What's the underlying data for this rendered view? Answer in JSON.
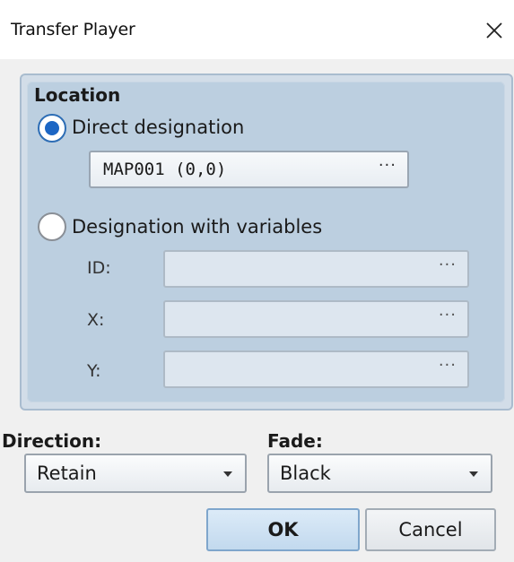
{
  "window": {
    "title": "Transfer Player",
    "close_icon": "close-icon"
  },
  "location": {
    "group_label": "Location",
    "direct": {
      "label": "Direct designation",
      "checked": true,
      "value": "MAP001 (0,0)",
      "browse_label": "···"
    },
    "variables": {
      "label": "Designation with variables",
      "checked": false,
      "fields": [
        {
          "label": "ID:",
          "value": "",
          "browse_label": "···"
        },
        {
          "label": "X:",
          "value": "",
          "browse_label": "···"
        },
        {
          "label": "Y:",
          "value": "",
          "browse_label": "···"
        }
      ]
    }
  },
  "direction": {
    "label": "Direction:",
    "value": "Retain"
  },
  "fade": {
    "label": "Fade:",
    "value": "Black"
  },
  "buttons": {
    "ok_label": "OK",
    "cancel_label": "Cancel"
  },
  "colors": {
    "group_background": "#bccfe0",
    "radio_selected": "#1c66c4",
    "ok_button": "#c2d9ee"
  }
}
